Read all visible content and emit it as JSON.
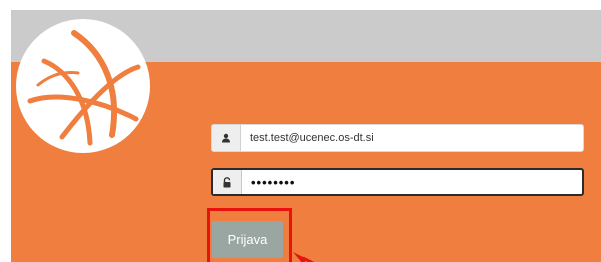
{
  "colors": {
    "brand": "#f07f3f",
    "topbar": "#cbcbcb",
    "button": "#9aa6a1",
    "highlight": "#e8130c"
  },
  "logo": {
    "icon": "swirl-logo-icon"
  },
  "login_form": {
    "email": {
      "icon": "user-icon",
      "value": "test.test@ucenec.os-dt.si"
    },
    "password": {
      "icon": "lock-icon",
      "value": "••••••••"
    },
    "submit_label": "Prijava"
  },
  "annotation": {
    "type": "highlight-box-with-arrow",
    "target": "login-button"
  }
}
